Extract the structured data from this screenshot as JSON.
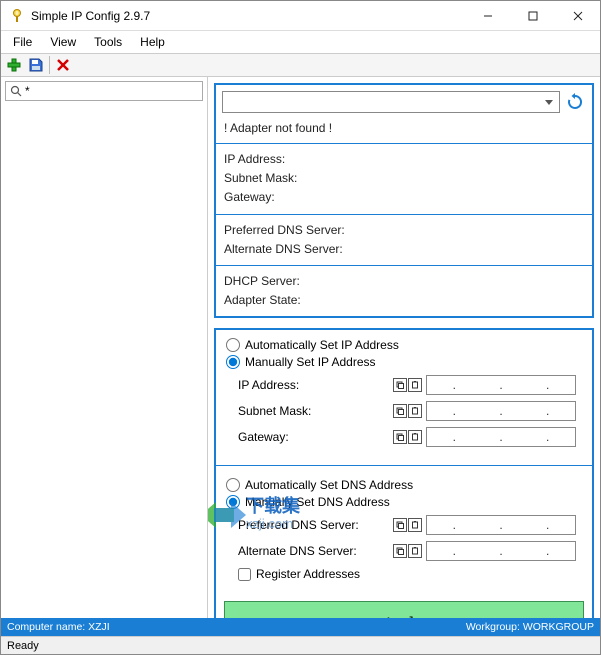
{
  "titlebar": {
    "title": "Simple IP Config 2.9.7"
  },
  "menu": {
    "file": "File",
    "view": "View",
    "tools": "Tools",
    "help": "Help"
  },
  "search": {
    "value": "*"
  },
  "adapter": {
    "notfound": "! Adapter not found !"
  },
  "info": {
    "ip": "IP Address:",
    "subnet": "Subnet Mask:",
    "gateway": "Gateway:",
    "pref_dns": "Preferred DNS Server:",
    "alt_dns": "Alternate DNS Server:",
    "dhcp": "DHCP Server:",
    "state": "Adapter State:"
  },
  "ip_section": {
    "auto": "Automatically Set IP Address",
    "manual": "Manually Set IP Address",
    "ip_label": "IP Address:",
    "subnet_label": "Subnet Mask:",
    "gateway_label": "Gateway:"
  },
  "dns_section": {
    "auto": "Automatically Set DNS Address",
    "manual": "Manually Set DNS Address",
    "pref_label": "Preferred DNS Server:",
    "alt_label": "Alternate DNS Server:",
    "register": "Register Addresses"
  },
  "apply": "Apply",
  "footer": {
    "computer": "Computer name: XZJI",
    "workgroup": "Workgroup: WORKGROUP",
    "status": "Ready"
  },
  "watermark": {
    "text": "下载集",
    "url": "xzji.com"
  }
}
